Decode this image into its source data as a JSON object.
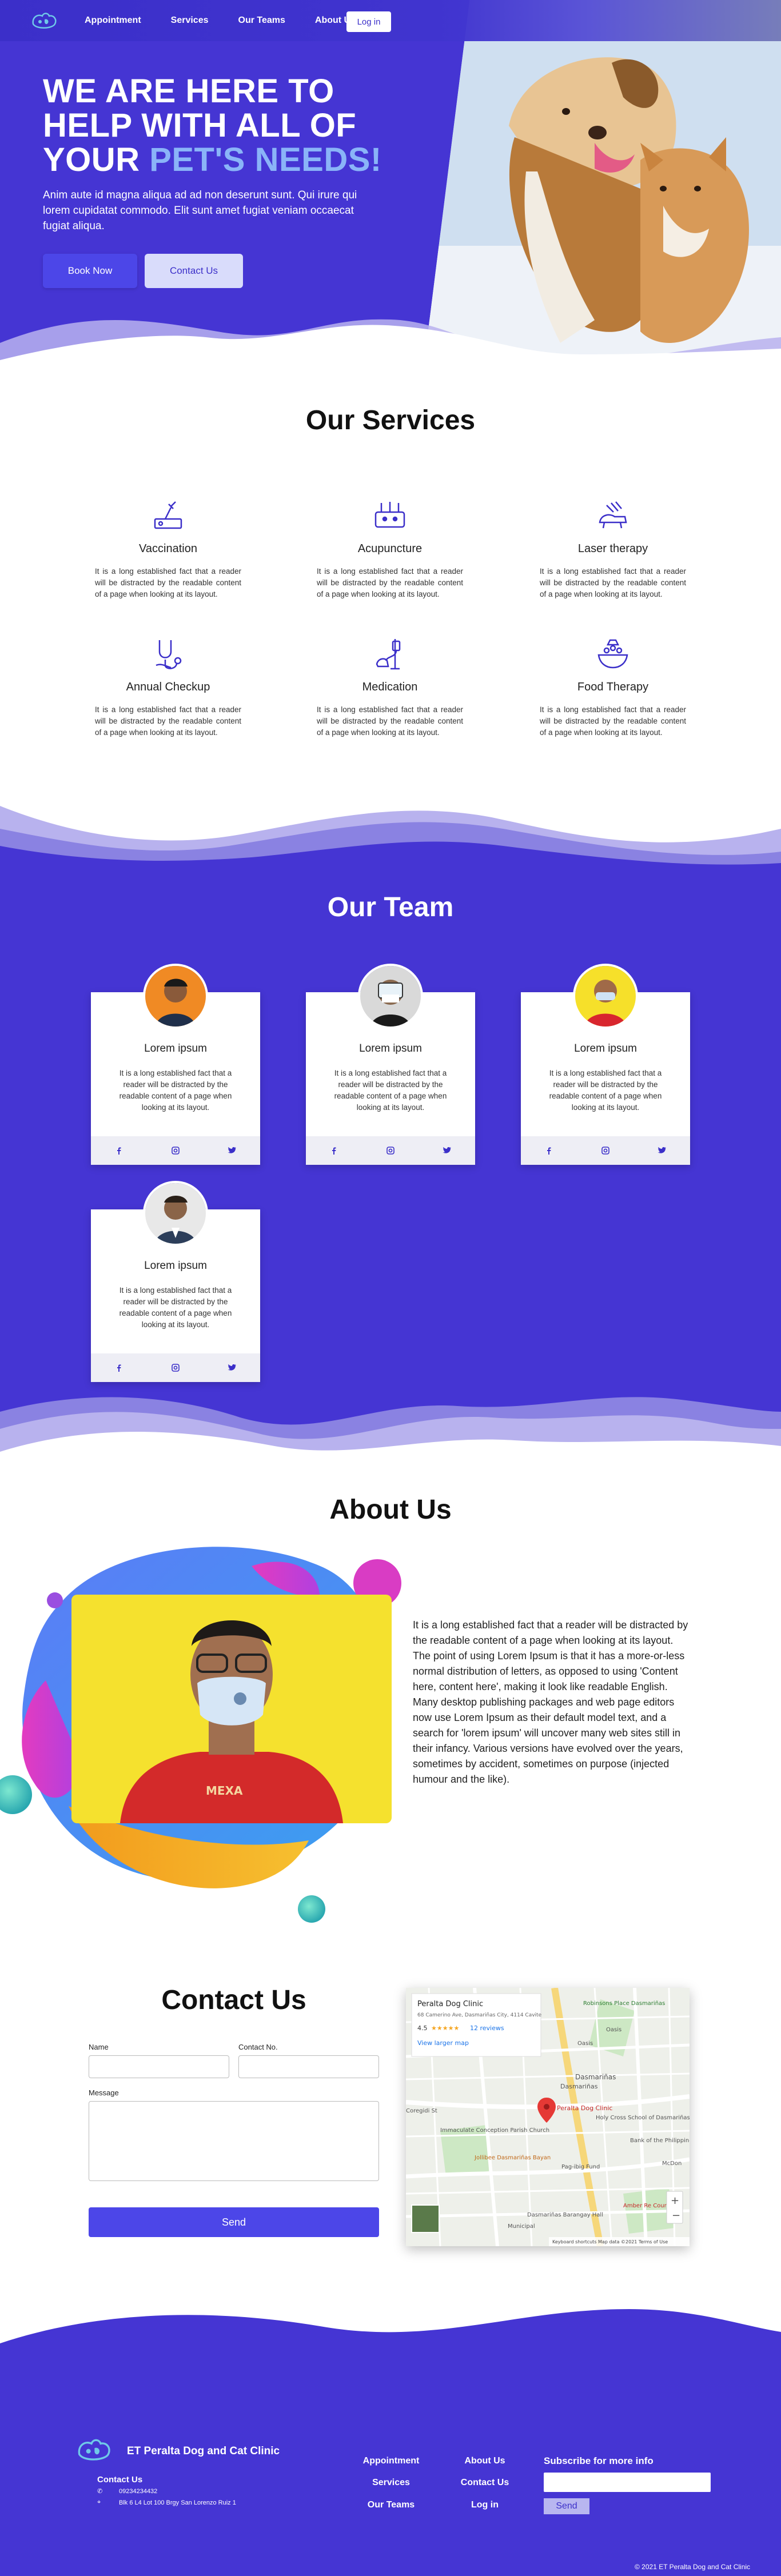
{
  "nav": {
    "links": [
      "Appointment",
      "Services",
      "Our Teams",
      "About Us"
    ],
    "login": "Log in"
  },
  "hero": {
    "title_line1": "WE ARE HERE TO",
    "title_line2": "HELP WITH ALL OF",
    "title_line3_plain": "YOUR ",
    "title_line3_accent": "PET'S NEEDS!",
    "description": "Anim aute id magna aliqua ad ad non deserunt sunt. Qui irure qui lorem cupidatat commodo. Elit sunt amet fugiat veniam occaecat fugiat aliqua.",
    "book_button": "Book Now",
    "contact_button": "Contact Us"
  },
  "services": {
    "title": "Our Services",
    "items": [
      {
        "name": "Vaccination",
        "icon": "vaccination-icon",
        "text": "It is a long established fact that a reader will be distracted by the readable content of a page when looking at its layout."
      },
      {
        "name": "Acupuncture",
        "icon": "acupuncture-icon",
        "text": "It is a long established fact that a reader will be distracted by the readable content of a page when looking at its layout."
      },
      {
        "name": "Laser therapy",
        "icon": "laser-therapy-icon",
        "text": "It is a long established fact that a reader will be distracted by the readable content of a page when looking at its layout."
      },
      {
        "name": "Annual Checkup",
        "icon": "stethoscope-icon",
        "text": "It is a long established fact that a reader will be distracted by the readable content of a page when looking at its layout."
      },
      {
        "name": "Medication",
        "icon": "iv-drip-icon",
        "text": "It is a long established fact that a reader will be distracted by the readable content of a page when looking at its layout."
      },
      {
        "name": "Food Therapy",
        "icon": "pet-food-bowl-icon",
        "text": "It is a long established fact that a reader will be distracted by the readable content of a page when looking at its layout."
      }
    ]
  },
  "team": {
    "title": "Our Team",
    "members": [
      {
        "name": "Lorem ipsum",
        "text": "It is a long established fact that a reader will be distracted by the readable content of a page when looking at its layout."
      },
      {
        "name": "Lorem ipsum",
        "text": "It is a long established fact that a reader will be distracted by the readable content of a page when looking at its layout."
      },
      {
        "name": "Lorem ipsum",
        "text": "It is a long established fact that a reader will be distracted by the readable content of a page when looking at its layout."
      },
      {
        "name": "Lorem ipsum",
        "text": "It is a long established fact that a reader will be distracted by the readable content of a page when looking at its layout."
      }
    ]
  },
  "about": {
    "title": "About Us",
    "text": "It is a long established fact that a reader will be distracted by the readable content of a page when looking at its layout. The point of using Lorem Ipsum is that it has a more-or-less normal distribution of letters, as opposed to using 'Content here, content here', making it look like readable English. Many desktop publishing packages and web page editors now use Lorem Ipsum as their default model text, and a search for 'lorem ipsum' will uncover many web sites still in their infancy. Various versions have evolved over the years, sometimes by accident, sometimes on purpose (injected humour and the like)."
  },
  "contact": {
    "title": "Contact Us",
    "name_label": "Name",
    "contact_label": "Contact No.",
    "message_label": "Message",
    "send_button": "Send",
    "map": {
      "place_name": "Peralta Dog Clinic",
      "address": "68 Camerino Ave, Dasmariñas City, 4114 Cavite",
      "rating": "4.5",
      "reviews": "12 reviews",
      "view_larger": "View larger map",
      "pin_label": "Peralta Dog Clinic",
      "labels": [
        "Dasmariñas",
        "Dasmariñas",
        "Immaculate Conception Parish Church",
        "Jollibee Dasmariñas Bayan",
        "Pag-ibig Fund",
        "Holy Cross School of Dasmariñas",
        "Robinsons Place Dasmariñas",
        "Bank of the Philippines",
        "McDon",
        "Dasmariñas Barangay Hall",
        "Municipal",
        "Amber Re County",
        "Oasis",
        "Coregidi St",
        "Oasis"
      ],
      "footer": "Keyboard shortcuts  Map data ©2021  Terms of Use"
    }
  },
  "footer": {
    "brand": "ET Peralta Dog and Cat Clinic",
    "contact_heading": "Contact Us",
    "phone": "09234234432",
    "address": "Blk 6 L4 Lot 100 Brgy San Lorenzo Ruiz 1",
    "links": [
      "Appointment",
      "About Us",
      "Services",
      "Contact Us",
      "Our Teams",
      "Log in"
    ],
    "subscribe_heading": "Subscribe for more info",
    "send_button": "Send",
    "copyright": "© 2021 ET Peralta Dog and Cat Clinic"
  },
  "colors": {
    "primary": "#4535d3",
    "button": "#4c46e8",
    "accent_text": "#8ab4f8"
  }
}
